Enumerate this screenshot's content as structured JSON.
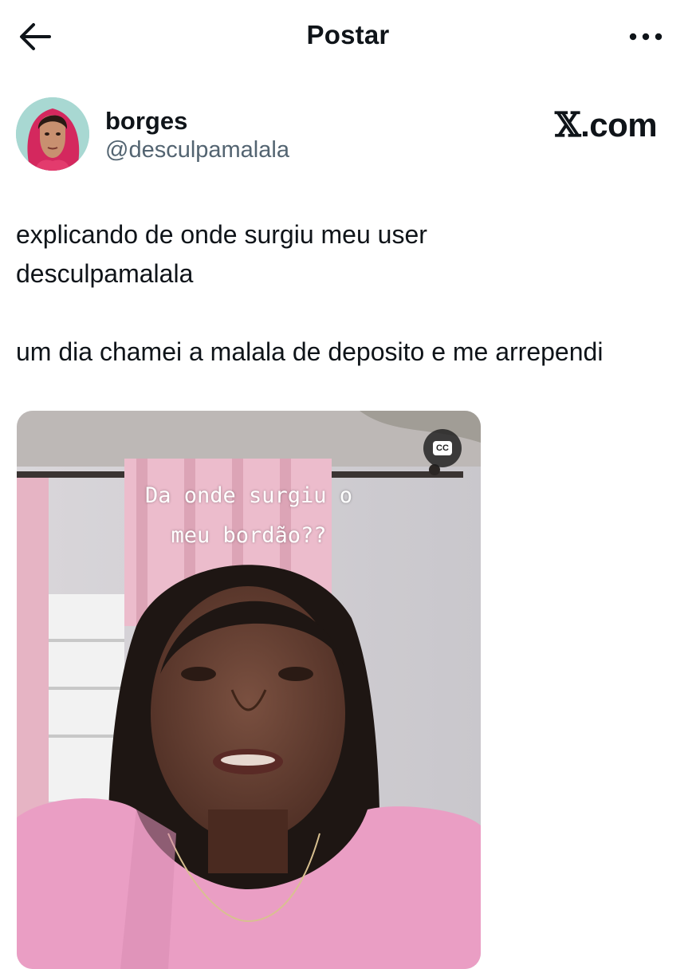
{
  "header": {
    "title": "Postar",
    "back_icon": "arrow-left-icon",
    "more_icon": "more-horizontal-icon"
  },
  "tweet": {
    "author": {
      "display_name": "borges",
      "handle": "@desculpamalala"
    },
    "brand": {
      "x_glyph": "𝕏",
      "domain": ".com"
    },
    "text": "explicando de onde surgiu meu user\ndesculpamalala\n\num dia chamei a malala de deposito e me arrependi",
    "media": {
      "type": "video",
      "caption_line1": "Da onde surgiu o",
      "caption_line2": "meu bordão??",
      "cc_label": "CC"
    }
  },
  "colors": {
    "text_primary": "#0f1419",
    "text_secondary": "#536471",
    "background": "#ffffff"
  }
}
